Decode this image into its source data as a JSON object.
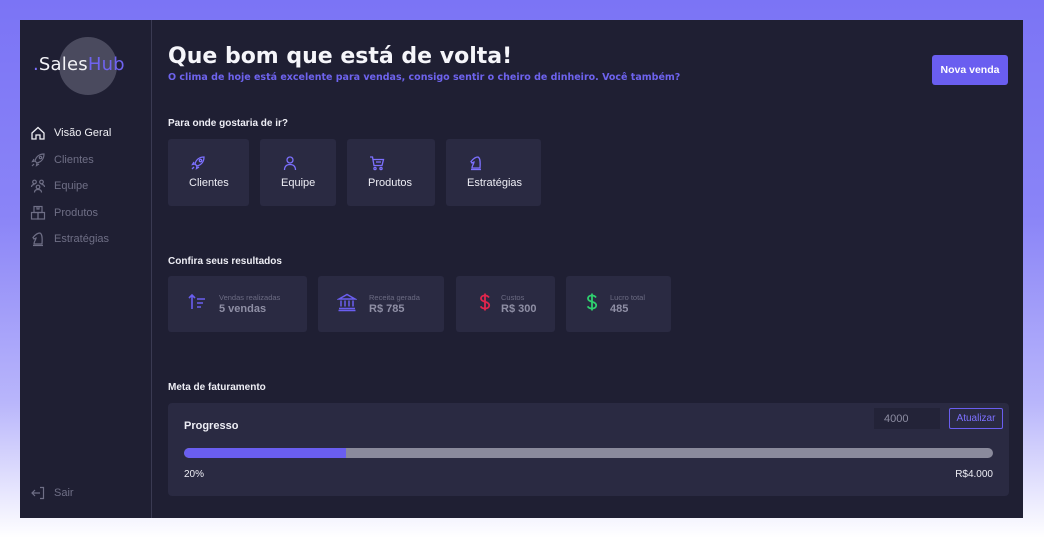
{
  "sidebar": {
    "logo": {
      "dot": ".",
      "part1": "Sales",
      "part2": "Hub"
    },
    "items": [
      {
        "label": "Visão Geral",
        "icon": "home-icon",
        "active": true
      },
      {
        "label": "Clientes",
        "icon": "rocket-icon",
        "active": false
      },
      {
        "label": "Equipe",
        "icon": "users-icon",
        "active": false
      },
      {
        "label": "Produtos",
        "icon": "box-icon",
        "active": false
      },
      {
        "label": "Estratégias",
        "icon": "chess-knight-icon",
        "active": false
      }
    ],
    "logout_label": "Sair"
  },
  "header": {
    "title": "Que bom que está de volta!",
    "subtitle": "O clima de hoje está excelente para vendas, consigo sentir o cheiro de dinheiro. Você também?",
    "new_sale_label": "Nova venda"
  },
  "navigation": {
    "title": "Para onde gostaria de ir?",
    "cards": [
      {
        "label": "Clientes",
        "icon": "rocket-icon"
      },
      {
        "label": "Equipe",
        "icon": "user-icon"
      },
      {
        "label": "Produtos",
        "icon": "cart-icon"
      },
      {
        "label": "Estratégias",
        "icon": "chess-knight-icon"
      }
    ]
  },
  "results": {
    "title": "Confira seus resultados",
    "stats": [
      {
        "label": "Vendas realizadas",
        "value": "5 vendas",
        "icon": "sort-ascending-icon",
        "color": "#6a5ef0"
      },
      {
        "label": "Receita gerada",
        "value": "R$ 785",
        "icon": "bank-icon",
        "color": "#6a5ef0"
      },
      {
        "label": "Custos",
        "value": "R$ 300",
        "icon": "dollar-icon",
        "color": "#e0264d"
      },
      {
        "label": "Lucro total",
        "value": "485",
        "icon": "dollar-icon",
        "color": "#2fd06f"
      }
    ]
  },
  "goal": {
    "title": "Meta de faturamento",
    "progress_title": "Progresso",
    "input_value": "4000",
    "update_label": "Atualizar",
    "percent_label": "20%",
    "progress_fraction": 0.2,
    "target_label": "R$4.000"
  },
  "colors": {
    "accent": "#6a5ef0",
    "background": "#1f1f33",
    "card": "#2a2a42"
  }
}
